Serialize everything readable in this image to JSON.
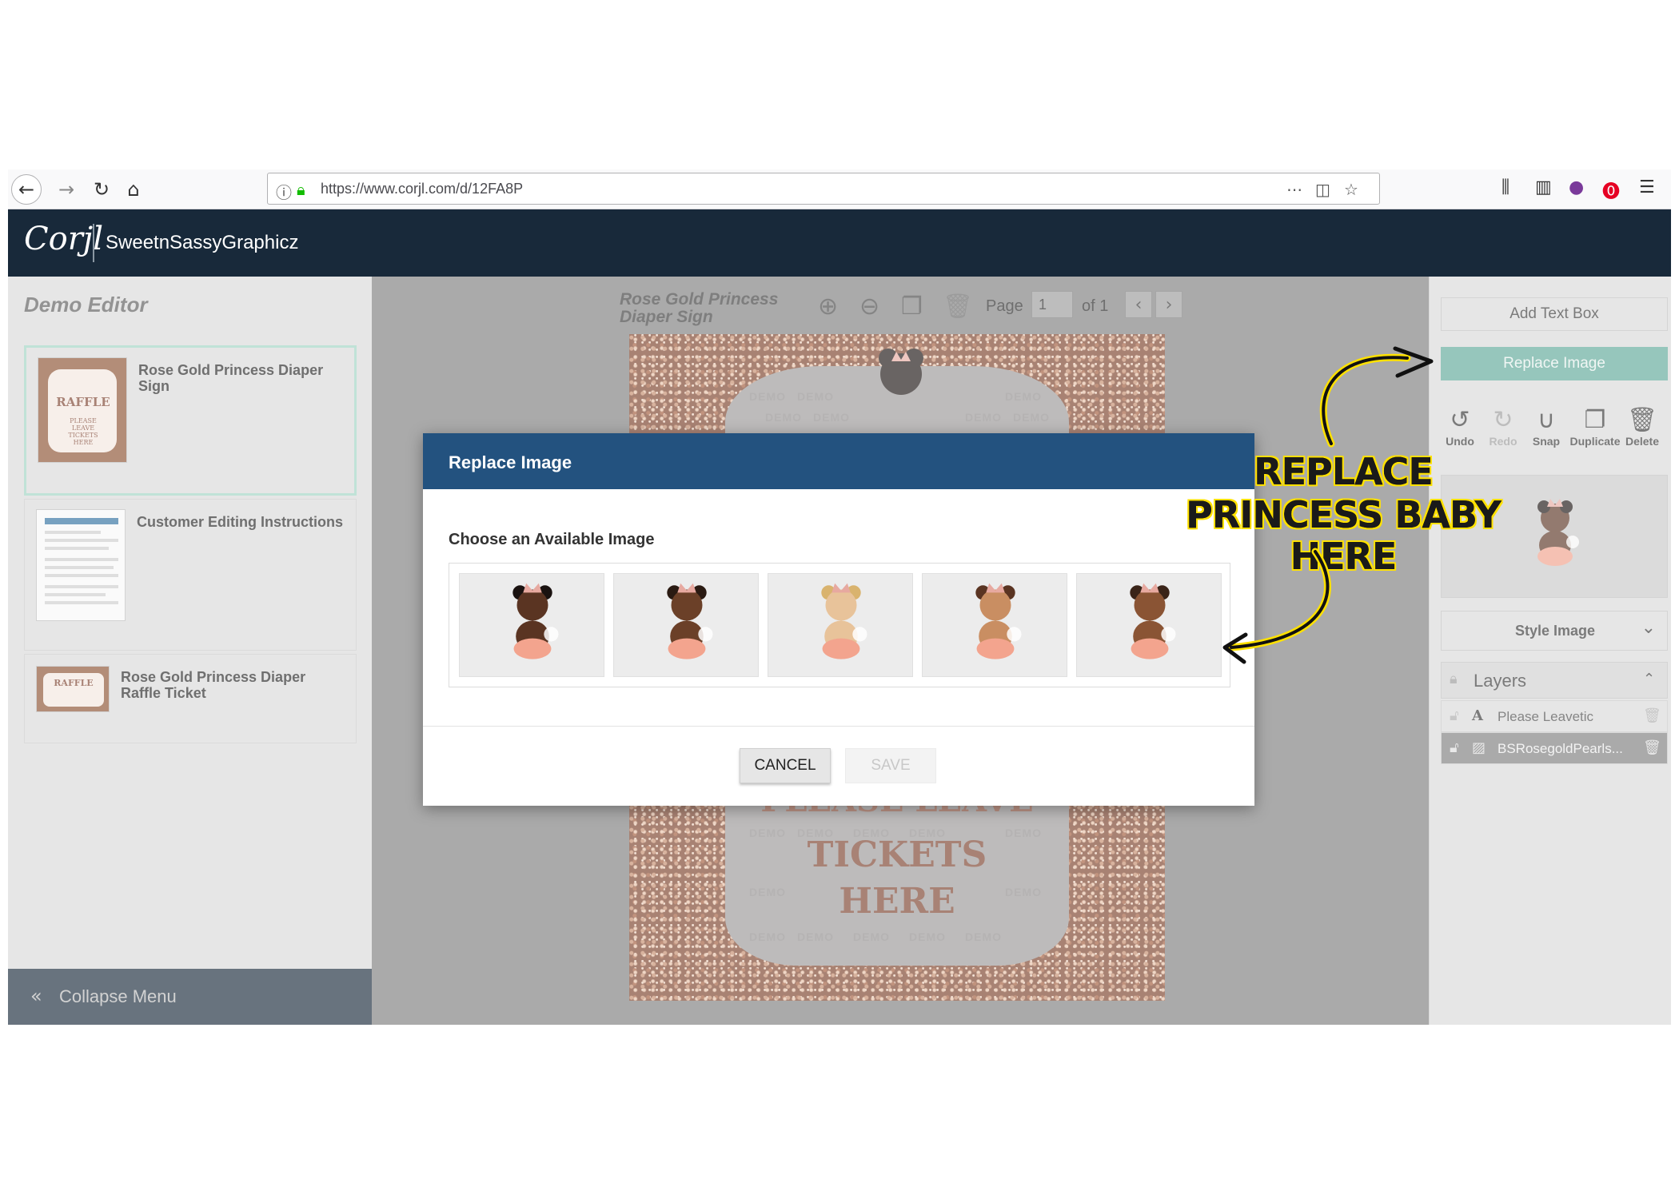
{
  "browser": {
    "url": "https://www.corjl.com/d/12FA8P",
    "back_icon": "arrow-left-icon",
    "forward_icon": "arrow-right-icon"
  },
  "app": {
    "logo": "Corjl",
    "brand": "SweetnSassyGraphicz"
  },
  "left_panel": {
    "title": "Demo Editor",
    "templates": [
      {
        "name": "Rose Gold Princess Diaper Sign",
        "thumb_text_1": "RAFFLE",
        "thumb_text_2": "PLEASE LEAVE TICKETS HERE"
      },
      {
        "name": "Customer Editing Instructions"
      },
      {
        "name": "Rose Gold Princess Diaper Raffle Ticket",
        "thumb_text_1": "RAFFLE"
      }
    ],
    "collapse_label": "Collapse Menu"
  },
  "canvas": {
    "doc_title": "Rose Gold Princess Diaper Sign",
    "page_label": "Page",
    "page_value": "1",
    "page_of": "of 1",
    "design_line_1": "TICKETS",
    "design_line_2": "HERE",
    "design_partial": "PLEASE LEAVE",
    "watermark": "DEMO"
  },
  "right_panel": {
    "add_text_box": "Add Text Box",
    "replace_image": "Replace Image",
    "tools": [
      {
        "label": "Undo",
        "icon": "undo-icon",
        "enabled": true
      },
      {
        "label": "Redo",
        "icon": "redo-icon",
        "enabled": false
      },
      {
        "label": "Snap",
        "icon": "magnet-icon",
        "enabled": true
      },
      {
        "label": "Duplicate",
        "icon": "duplicate-icon",
        "enabled": true
      },
      {
        "label": "Delete",
        "icon": "trash-icon",
        "enabled": true
      }
    ],
    "style_image": "Style Image",
    "layers_label": "Layers",
    "layers": [
      {
        "name": "Please Leavetic",
        "type": "text",
        "selected": false
      },
      {
        "name": "BSRosegoldPearls...",
        "type": "image",
        "selected": true
      }
    ]
  },
  "modal": {
    "title": "Replace Image",
    "subtitle": "Choose an Available Image",
    "options": [
      {
        "skin": "#5a3422",
        "hair": "#1a1210"
      },
      {
        "skin": "#6b4028",
        "hair": "#2a1a12"
      },
      {
        "skin": "#e8c39a",
        "hair": "#d9b36e"
      },
      {
        "skin": "#c98e62",
        "hair": "#5a3422"
      },
      {
        "skin": "#8a5434",
        "hair": "#3a2418"
      }
    ],
    "cancel": "CANCEL",
    "save": "SAVE"
  },
  "annotation": {
    "line_1": "REPLACE",
    "line_2": "PRINCESS BABY HERE"
  },
  "colors": {
    "header": "#18293a",
    "modal_header": "#23527f",
    "replace_button": "#5fa898",
    "annotation_fill": "#1a1a1a",
    "annotation_outline": "#ffe100"
  }
}
